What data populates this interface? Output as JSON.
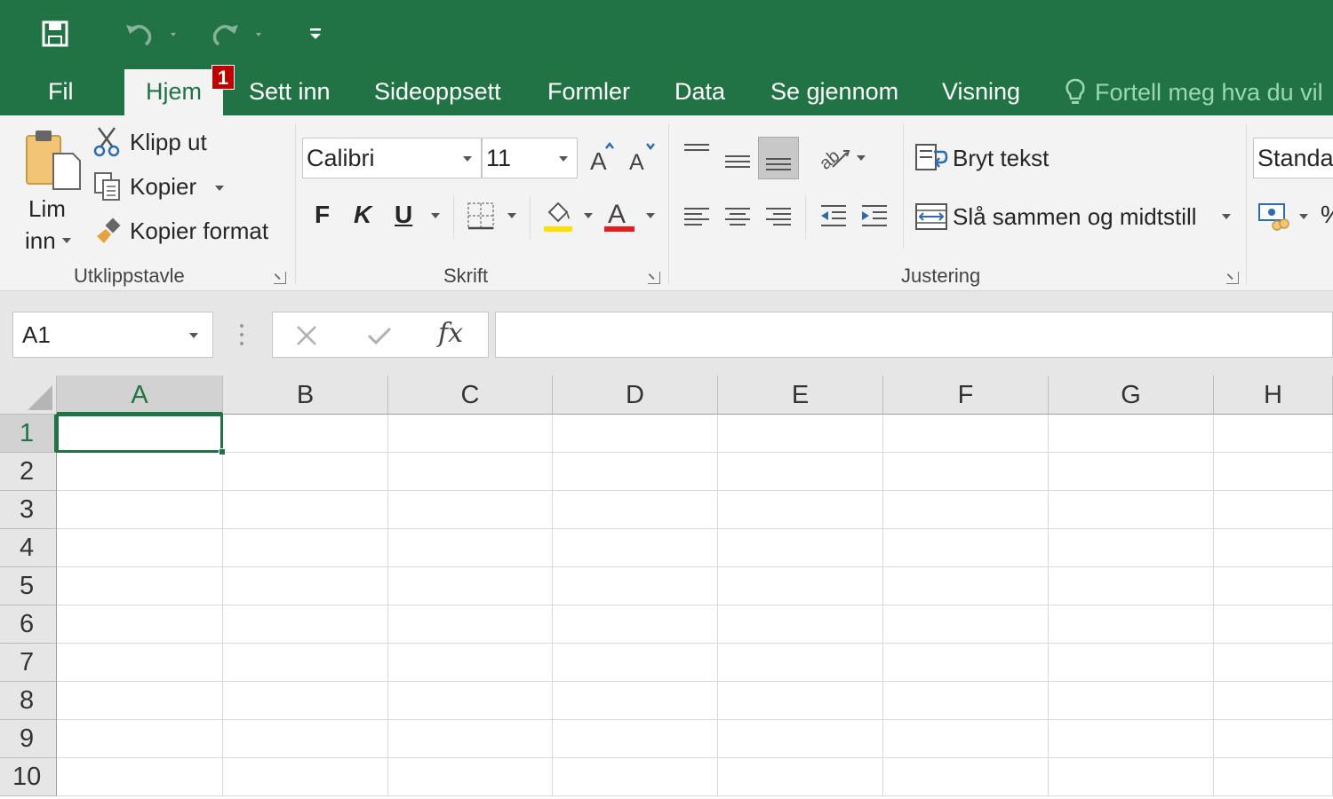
{
  "tabs": {
    "items": [
      {
        "label": "Fil"
      },
      {
        "label": "Hjem"
      },
      {
        "label": "Sett inn"
      },
      {
        "label": "Sideoppsett"
      },
      {
        "label": "Formler"
      },
      {
        "label": "Data"
      },
      {
        "label": "Se gjennom"
      },
      {
        "label": "Visning"
      }
    ],
    "active": "Hjem",
    "badge": "1",
    "tell_me": "Fortell meg hva du vil"
  },
  "ribbon": {
    "clipboard": {
      "paste_line1": "Lim",
      "paste_line2": "inn",
      "cut": "Klipp ut",
      "copy": "Kopier",
      "format_painter": "Kopier format",
      "group_label": "Utklippstavle"
    },
    "font": {
      "font_name": "Calibri",
      "font_size": "11",
      "bold": "F",
      "italic": "K",
      "underline": "U",
      "group_label": "Skrift"
    },
    "alignment": {
      "wrap_text": "Bryt tekst",
      "merge_center": "Slå sammen og midtstill",
      "group_label": "Justering"
    },
    "number": {
      "format": "Standa",
      "percent": "%"
    }
  },
  "formula_bar": {
    "name_box": "A1",
    "fx": "fx",
    "value": ""
  },
  "grid": {
    "columns": [
      "A",
      "B",
      "C",
      "D",
      "E",
      "F",
      "G",
      "H"
    ],
    "rows": [
      "1",
      "2",
      "3",
      "4",
      "5",
      "6",
      "7",
      "8",
      "9",
      "10"
    ],
    "active_cell": "A1"
  },
  "colors": {
    "accent": "#217346",
    "badge": "#c00000",
    "highlight_yellow": "#ffe000",
    "font_red": "#e02020"
  }
}
